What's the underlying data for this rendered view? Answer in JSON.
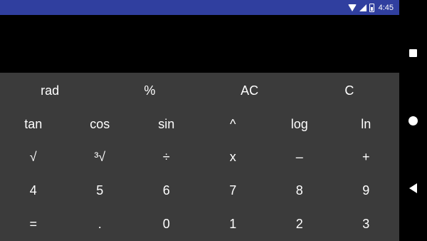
{
  "status_bar": {
    "time": "4:45",
    "icons": [
      "wifi-icon",
      "signal-icon",
      "battery-icon"
    ],
    "background_color": "#303f9f"
  },
  "display": {
    "expression": "",
    "result": ""
  },
  "keypad": {
    "background_color": "#3b3b3b",
    "rows": [
      [
        "rad",
        "%",
        "AC",
        "C"
      ],
      [
        "tan",
        "cos",
        "sin",
        "^",
        "log",
        "ln"
      ],
      [
        "√",
        "³√",
        "÷",
        "x",
        "–",
        "+"
      ],
      [
        "4",
        "5",
        "6",
        "7",
        "8",
        "9"
      ],
      [
        "=",
        ".",
        "0",
        "1",
        "2",
        "3"
      ]
    ]
  },
  "nav_bar": {
    "buttons": [
      "recents-icon",
      "home-icon",
      "back-icon"
    ]
  }
}
